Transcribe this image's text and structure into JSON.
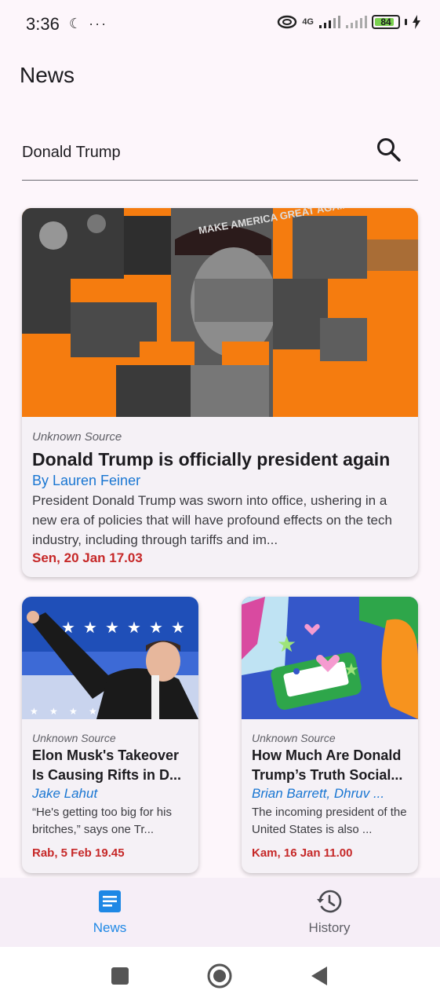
{
  "status_bar": {
    "time": "3:36",
    "left_icons": "☾ ···",
    "network": "4G",
    "battery": "84",
    "battery_level": 0.84
  },
  "app_bar": {
    "title": "News"
  },
  "search": {
    "value": "Donald Trump",
    "icon": "search-icon"
  },
  "featured_article": {
    "source": "Unknown Source",
    "title": "Donald Trump is officially president again",
    "author": "By Lauren Feiner",
    "description": "President Donald Trump was sworn into office, ushering in a new era of policies that will have profound effects on the tech industry, including through tariffs and im...",
    "date": "Sen, 20 Jan 17.03",
    "image_caption_text": "MAKE AMERICA GREAT AGAIN"
  },
  "articles": [
    {
      "source": "Unknown Source",
      "title": "Elon Musk's Takeover Is Causing Rifts in D...",
      "author": "Jake Lahut",
      "description": "“He's getting too big for his britches,” says one Tr...",
      "date": "Rab, 5 Feb 19.45"
    },
    {
      "source": "Unknown Source",
      "title": "How Much Are Donald Trump’s Truth Social...",
      "author": "Brian Barrett, Dhruv ...",
      "description": "The incoming president of the United States is also ...",
      "date": "Kam, 16 Jan 11.00"
    }
  ],
  "bottom_nav": {
    "items": [
      {
        "label": "News",
        "icon": "news-icon",
        "active": true
      },
      {
        "label": "History",
        "icon": "history-icon",
        "active": false
      }
    ]
  },
  "system_nav": {
    "icons": [
      "recents-icon",
      "home-icon",
      "back-icon"
    ]
  },
  "colors": {
    "background": "#fdf6fb",
    "accent": "#1e88e5",
    "author_link": "#1976d2",
    "date_red": "#c62828",
    "orange": "#f57c0f"
  }
}
